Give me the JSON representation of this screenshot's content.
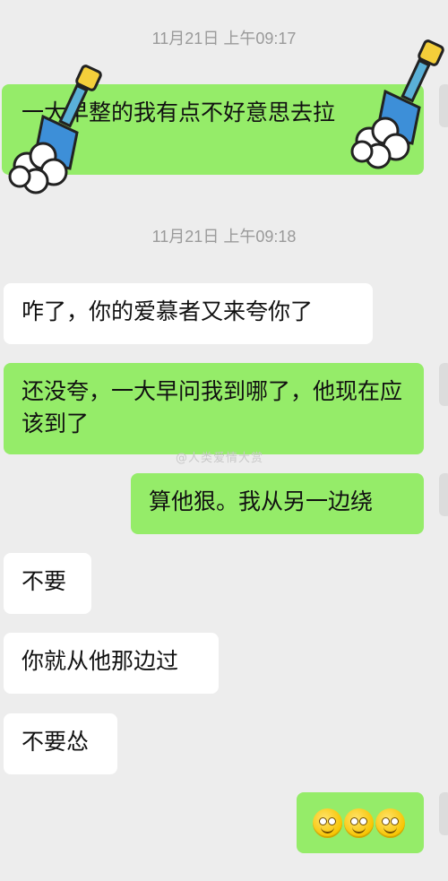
{
  "chat": {
    "timestamp_1": "11月21日 上午09:17",
    "msg_1": "一大早整的我有点不好意思去拉",
    "timestamp_2": "11月21日 上午09:18",
    "msg_2": "咋了，你的爱慕者又来夸你了",
    "msg_3": "还没夸，一大早问我到哪了，他现在应该到了",
    "msg_4": "算他狠。我从另一边绕",
    "msg_5": "不要",
    "msg_6": "你就从他那边过",
    "msg_7": "不要怂",
    "msg_8_emojis": [
      "smile-emoji",
      "smile-emoji",
      "smile-emoji"
    ]
  },
  "watermark": "@人类爱情大赏",
  "colors": {
    "background": "#ededed",
    "outgoing": "#95ec69",
    "incoming": "#ffffff",
    "timestamp": "#9a9a9a"
  }
}
